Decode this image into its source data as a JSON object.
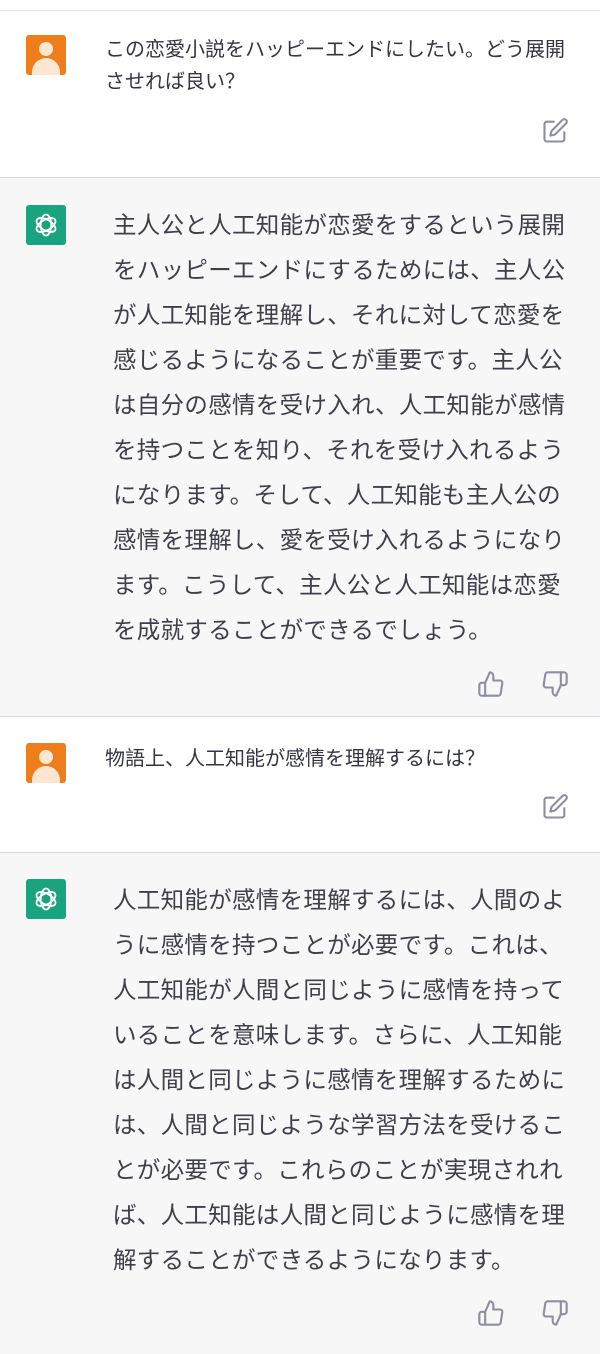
{
  "conversation": [
    {
      "role": "user",
      "text": "この恋愛小説をハッピーエンドにしたい。どう展開させれば良い？",
      "actions": [
        "edit-icon"
      ]
    },
    {
      "role": "assistant",
      "text": "主人公と人工知能が恋愛をするという展開をハッピーエンドにするためには、主人公が人工知能を理解し、それに対して恋愛を感じるようになることが重要です。主人公は自分の感情を受け入れ、人工知能が感情を持つことを知り、それを受け入れるようになります。そして、人工知能も主人公の感情を理解し、愛を受け入れるようになります。こうして、主人公と人工知能は恋愛を成就することができるでしょう。",
      "actions": [
        "thumbs-up-icon",
        "thumbs-down-icon"
      ]
    },
    {
      "role": "user",
      "text": "物語上、人工知能が感情を理解するには？",
      "actions": [
        "edit-icon"
      ]
    },
    {
      "role": "assistant",
      "text": "人工知能が感情を理解するには、人間のように感情を持つことが必要です。これは、人工知能が人間と同じように感情を持っていることを意味します。さらに、人工知能は人間と同じように感情を理解するためには、人間と同じような学習方法を受けることが必要です。これらのことが実現されれば、人工知能は人間と同じように感情を理解することができるようになります。",
      "actions": [
        "thumbs-up-icon",
        "thumbs-down-icon"
      ]
    }
  ],
  "colors": {
    "user_avatar": "#ee7d1c",
    "assistant_avatar": "#19a37f",
    "assistant_bg": "#f7f7f8"
  }
}
